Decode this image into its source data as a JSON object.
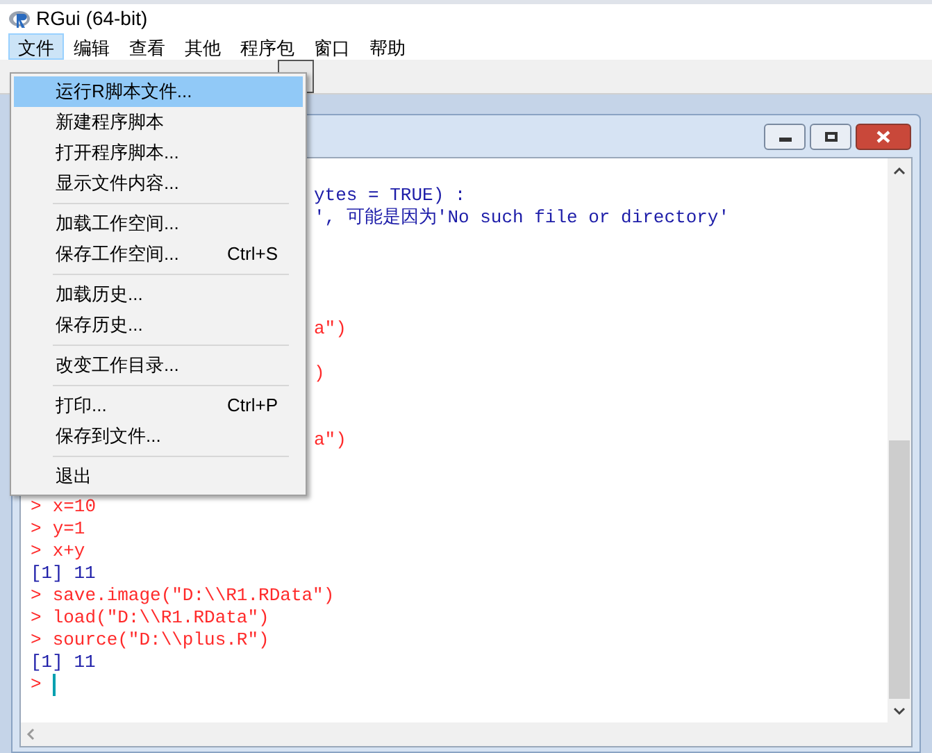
{
  "window": {
    "title": "RGui (64-bit)"
  },
  "menu_bar": [
    {
      "label": "文件",
      "selected": true
    },
    {
      "label": "编辑",
      "selected": false
    },
    {
      "label": "查看",
      "selected": false
    },
    {
      "label": "其他",
      "selected": false
    },
    {
      "label": "程序包",
      "selected": false
    },
    {
      "label": "窗口",
      "selected": false
    },
    {
      "label": "帮助",
      "selected": false
    }
  ],
  "file_menu": [
    {
      "kind": "item",
      "label": "运行R脚本文件...",
      "selected": true
    },
    {
      "kind": "item",
      "label": "新建程序脚本",
      "selected": false
    },
    {
      "kind": "item",
      "label": "打开程序脚本...",
      "selected": false
    },
    {
      "kind": "item",
      "label": "显示文件内容...",
      "selected": false
    },
    {
      "kind": "separator"
    },
    {
      "kind": "item",
      "label": "加载工作空间...",
      "selected": false
    },
    {
      "kind": "item",
      "label": "保存工作空间...",
      "shortcut": "Ctrl+S",
      "selected": false
    },
    {
      "kind": "separator"
    },
    {
      "kind": "item",
      "label": "加载历史...",
      "selected": false
    },
    {
      "kind": "item",
      "label": "保存历史...",
      "selected": false
    },
    {
      "kind": "separator"
    },
    {
      "kind": "item",
      "label": "改变工作目录...",
      "selected": false
    },
    {
      "kind": "separator"
    },
    {
      "kind": "item",
      "label": "打印...",
      "shortcut": "Ctrl+P",
      "selected": false
    },
    {
      "kind": "item",
      "label": "保存到文件...",
      "selected": false
    },
    {
      "kind": "separator"
    },
    {
      "kind": "item",
      "label": "退出",
      "selected": false
    }
  ],
  "console": {
    "lines": [
      {
        "kind": "output",
        "covered": true,
        "text": "ytes = TRUE) :"
      },
      {
        "kind": "output",
        "covered": true,
        "text": "', 可能是因为'No such file or directory'"
      },
      {
        "kind": "hidden"
      },
      {
        "kind": "hidden"
      },
      {
        "kind": "hidden"
      },
      {
        "kind": "hidden"
      },
      {
        "kind": "input",
        "covered": true,
        "text": "a\")"
      },
      {
        "kind": "hidden"
      },
      {
        "kind": "input",
        "covered": true,
        "text": ")"
      },
      {
        "kind": "hidden"
      },
      {
        "kind": "hidden"
      },
      {
        "kind": "input",
        "covered": true,
        "text": "a\")"
      },
      {
        "kind": "hidden"
      },
      {
        "kind": "hidden"
      },
      {
        "kind": "input",
        "prompt": ">",
        "text": "x=10"
      },
      {
        "kind": "input",
        "prompt": ">",
        "text": "y=1"
      },
      {
        "kind": "input",
        "prompt": ">",
        "text": "x+y"
      },
      {
        "kind": "output",
        "text": "[1] 11"
      },
      {
        "kind": "input",
        "prompt": ">",
        "text": "save.image(\"D:\\\\R1.RData\")"
      },
      {
        "kind": "input",
        "prompt": ">",
        "text": "load(\"D:\\\\R1.RData\")"
      },
      {
        "kind": "input",
        "prompt": ">",
        "text": "source(\"D:\\\\plus.R\")"
      },
      {
        "kind": "output",
        "text": "[1] 11"
      },
      {
        "kind": "cursor",
        "prompt": ">"
      }
    ]
  }
}
